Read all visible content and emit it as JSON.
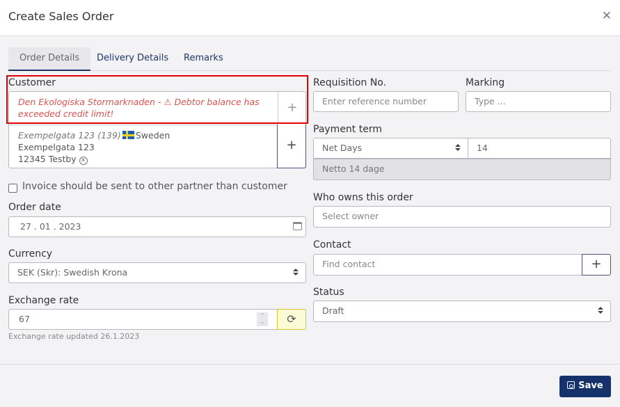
{
  "dialog": {
    "title": "Create Sales Order",
    "close_icon": "close-icon"
  },
  "tabs": [
    {
      "label": "Order Details",
      "active": true
    },
    {
      "label": "Delivery Details",
      "active": false
    },
    {
      "label": "Remarks",
      "active": false
    }
  ],
  "customer": {
    "label": "Customer",
    "name": "Den Ekologiska Stormarknaden - ",
    "warning_icon": "warning-icon",
    "warning_text": "Debtor balance has exceeded credit limit!",
    "address": {
      "line1_italic": "Exempelgata 123 (139)",
      "country": "Sweden",
      "country_flag": "sweden-flag-icon",
      "street": "Exempelgata 123",
      "city": "12345 Testby"
    },
    "add_symbol": "+"
  },
  "invoice_checkbox": {
    "label": "Invoice should be sent to other partner than customer",
    "checked": false
  },
  "order_date": {
    "label": "Order date",
    "value": "27 . 01 . 2023"
  },
  "currency": {
    "label": "Currency",
    "value": "SEK (Skr): Swedish Krona"
  },
  "exchange_rate": {
    "label": "Exchange rate",
    "value": "67",
    "hint": "Exchange rate updated 26.1.2023",
    "spin_up": "⌃",
    "spin_down": "⌄",
    "refresh_symbol": "⟳"
  },
  "requisition": {
    "label": "Requisition No.",
    "placeholder": "Enter reference number"
  },
  "marking": {
    "label": "Marking",
    "placeholder": "Type ..."
  },
  "payment_term": {
    "label": "Payment term",
    "type_value": "Net Days",
    "days_value": "14",
    "description": "Netto 14 dage"
  },
  "owner": {
    "label": "Who owns this order",
    "placeholder": "Select owner"
  },
  "contact": {
    "label": "Contact",
    "placeholder": "Find contact",
    "add_symbol": "+"
  },
  "status": {
    "label": "Status",
    "value": "Draft"
  },
  "footer": {
    "save_label": "Save"
  },
  "colors": {
    "primary": "#15336a",
    "warning": "#d9534f",
    "highlight": "#e00000",
    "refresh_bg": "#fdfbd6"
  }
}
